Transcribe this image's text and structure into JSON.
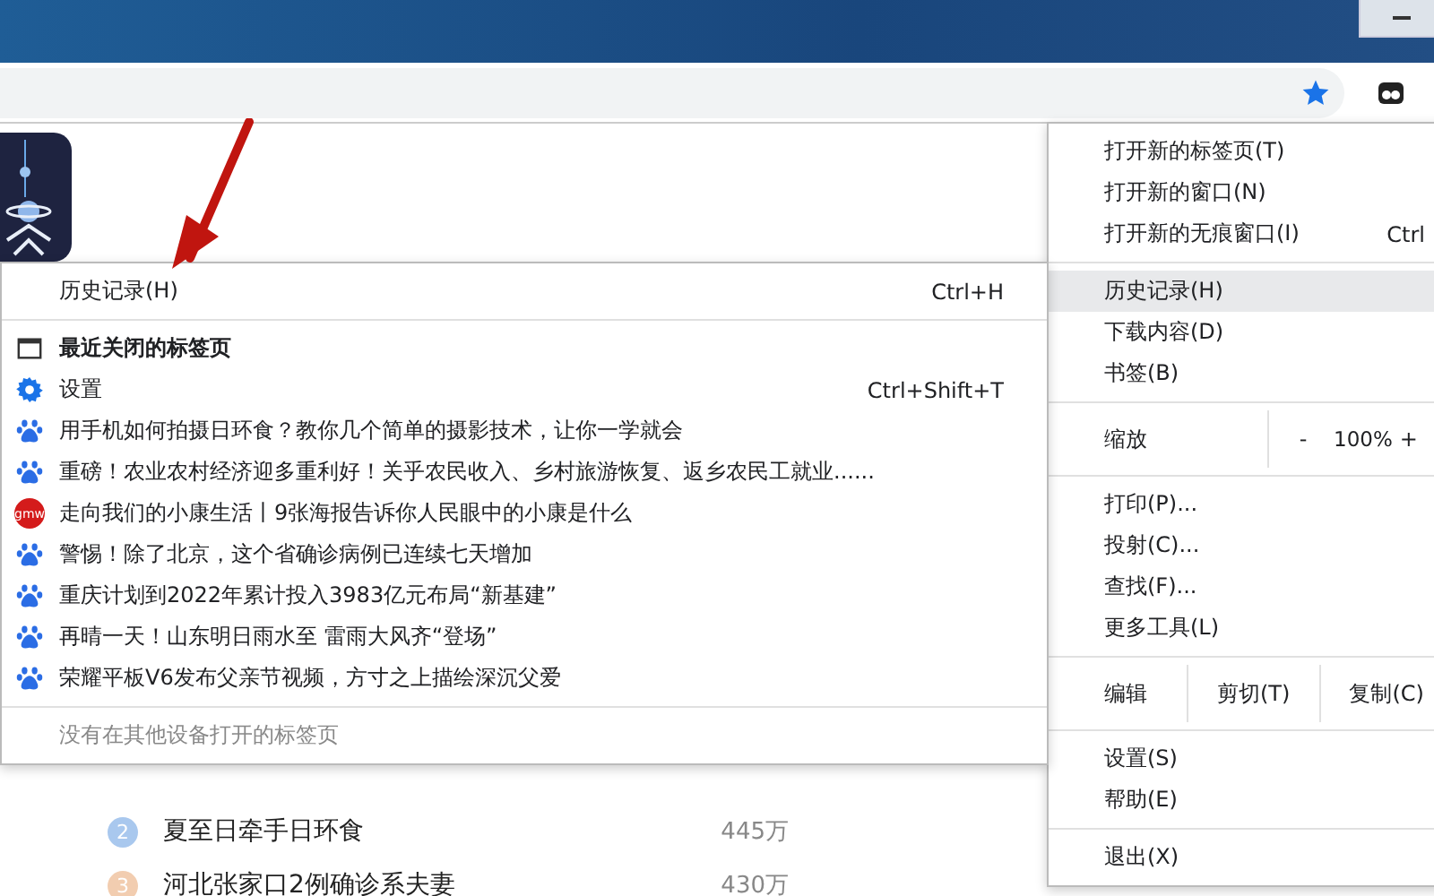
{
  "menu": {
    "items": [
      {
        "kind": "item",
        "label": "打开新的标签页(T)",
        "selected": false
      },
      {
        "kind": "item",
        "label": "打开新的窗口(N)",
        "selected": false
      },
      {
        "kind": "item",
        "label": "打开新的无痕窗口(I)",
        "shortcut": "Ctrl",
        "selected": false
      },
      {
        "kind": "separator"
      },
      {
        "kind": "item",
        "label": "历史记录(H)",
        "selected": true
      },
      {
        "kind": "item",
        "label": "下载内容(D)",
        "selected": false
      },
      {
        "kind": "item",
        "label": "书签(B)",
        "selected": false
      },
      {
        "kind": "separator"
      },
      {
        "kind": "zoom",
        "label": "缩放",
        "minus": "-",
        "value": "100%",
        "plus": "+"
      },
      {
        "kind": "separator"
      },
      {
        "kind": "item",
        "label": "打印(P)...",
        "selected": false
      },
      {
        "kind": "item",
        "label": "投射(C)...",
        "selected": false
      },
      {
        "kind": "item",
        "label": "查找(F)...",
        "selected": false
      },
      {
        "kind": "item",
        "label": "更多工具(L)",
        "selected": false
      },
      {
        "kind": "separator"
      },
      {
        "kind": "edit",
        "label": "编辑",
        "buttons": [
          "剪切(T)",
          "复制(C)"
        ]
      },
      {
        "kind": "separator"
      },
      {
        "kind": "item",
        "label": "设置(S)",
        "selected": false
      },
      {
        "kind": "item",
        "label": "帮助(E)",
        "selected": false
      },
      {
        "kind": "separator"
      },
      {
        "kind": "item",
        "label": "退出(X)",
        "selected": false
      }
    ]
  },
  "history_menu": {
    "title": "历史记录(H)",
    "shortcut": "Ctrl+H",
    "items": [
      {
        "kind": "tab",
        "label": "最近关闭的标签页",
        "bold": true
      },
      {
        "kind": "settings",
        "label": "设置",
        "shortcut": "Ctrl+Shift+T"
      },
      {
        "kind": "paw",
        "label": "用手机如何拍摄日环食？教你几个简单的摄影技术，让你一学就会"
      },
      {
        "kind": "paw",
        "label": "重磅！农业农村经济迎多重利好！关乎农民收入、乡村旅游恢复、返乡农民工就业......"
      },
      {
        "kind": "news",
        "label": "走向我们的小康生活丨9张海报告诉你人民眼中的小康是什么",
        "icon_text": "gmw"
      },
      {
        "kind": "paw",
        "label": "警惕！除了北京，这个省确诊病例已连续七天增加"
      },
      {
        "kind": "paw",
        "label": "重庆计划到2022年累计投入3983亿元布局“新基建”"
      },
      {
        "kind": "paw",
        "label": "再晴一天！山东明日雨水至 雷雨大风齐“登场”"
      },
      {
        "kind": "paw",
        "label": "荣耀平板V6发布父亲节视频，方寸之上描绘深沉父爱"
      }
    ],
    "footer": "没有在其他设备打开的标签页"
  },
  "hot_list": [
    {
      "rank": "2",
      "title": "夏至日牵手日环食",
      "count": "445万",
      "color": "#a9c8ee"
    },
    {
      "rank": "3",
      "title": "河北张家口2例确诊系夫妻",
      "count": "430万",
      "color": "#f2cdb0"
    }
  ]
}
